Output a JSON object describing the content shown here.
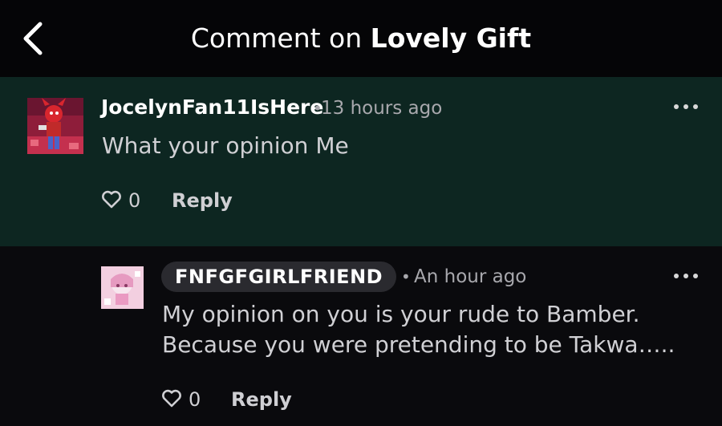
{
  "header": {
    "title_prefix": "Comment on",
    "title_subject": "Lovely Gift"
  },
  "comments": [
    {
      "username": "JocelynFan11IsHere",
      "time": "13 hours ago",
      "body": "What your opinion Me",
      "likes": "0",
      "reply_label": "Reply",
      "highlighted": true
    },
    {
      "username": "FNFGFGIRLFRIEND",
      "time": "An hour ago",
      "body": "My opinion on you is your rude to Bamber. Because you were pretending to be Takwa…..",
      "likes": "0",
      "reply_label": "Reply",
      "highlighted": false
    }
  ],
  "colors": {
    "header_bg": "#050507",
    "highlight_bg": "#0d2621",
    "page_bg": "#0a0a0d",
    "pill_bg": "#2a2a2f",
    "meta_text": "#a8a8ad"
  },
  "icons": {
    "back": "chevron-left-icon",
    "more": "more-horizontal-icon",
    "like": "heart-outline-icon"
  }
}
